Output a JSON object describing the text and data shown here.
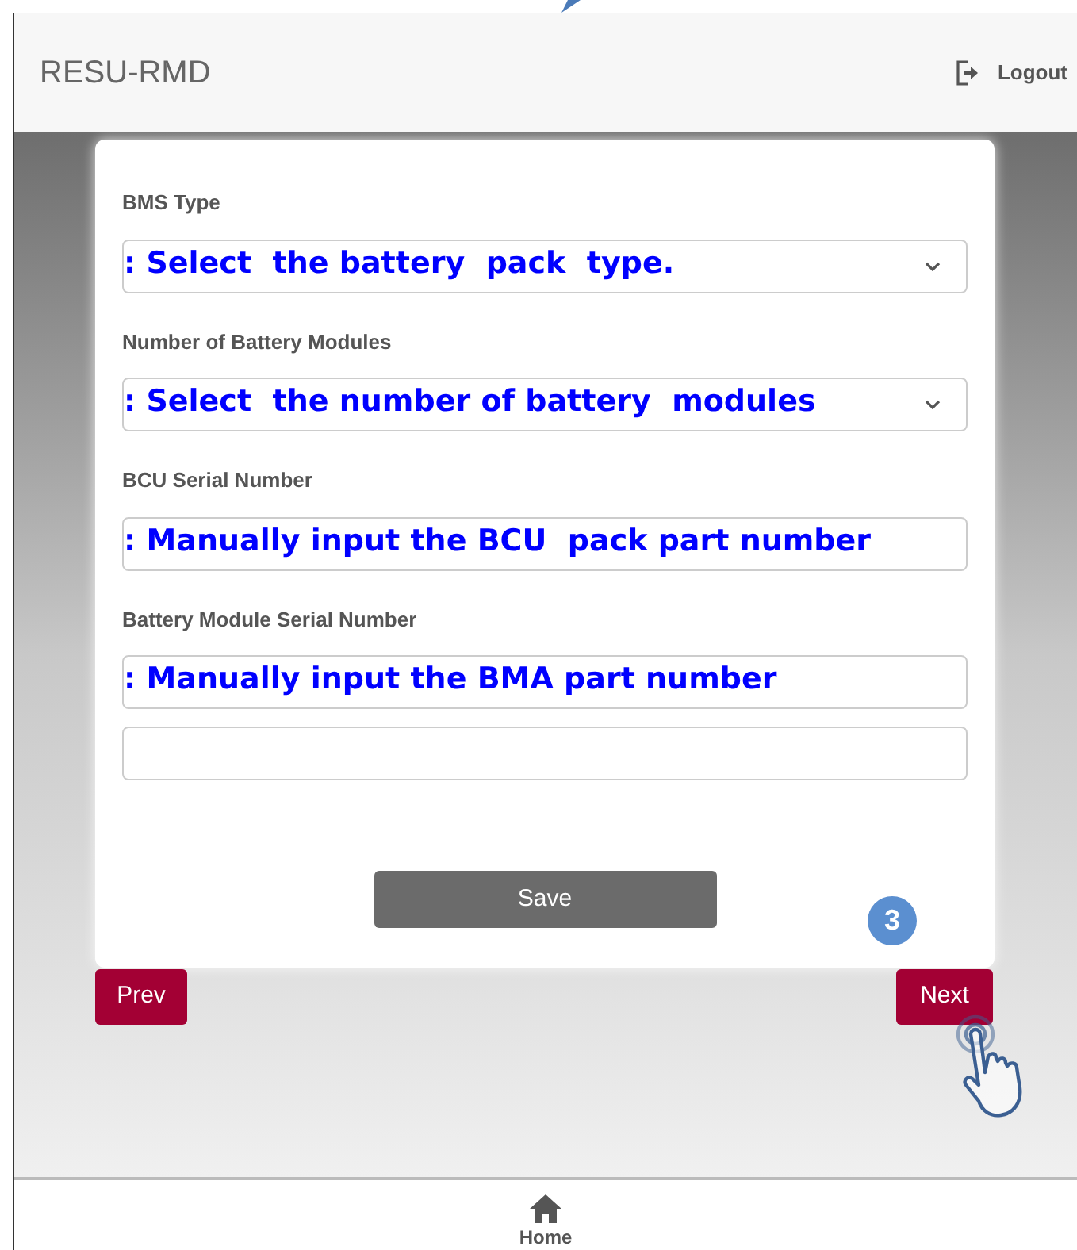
{
  "header": {
    "title": "RESU-RMD",
    "logout": "Logout"
  },
  "form": {
    "fields": [
      {
        "kind": "select",
        "label": "BMS Type",
        "annotation": ": Select  the battery  pack  type."
      },
      {
        "kind": "select",
        "label": "Number of Battery Modules",
        "annotation": ": Select  the number of battery  modules"
      },
      {
        "kind": "text",
        "label": "BCU Serial Number",
        "annotation": ": Manually input the BCU  pack part number"
      },
      {
        "kind": "text",
        "label": "Battery Module Serial Number",
        "annotation": ": Manually input the BMA part number"
      },
      {
        "kind": "text"
      }
    ],
    "save": "Save"
  },
  "step_badge": "3",
  "nav": {
    "prev": "Prev",
    "next": "Next"
  },
  "footer": {
    "home": "Home"
  }
}
